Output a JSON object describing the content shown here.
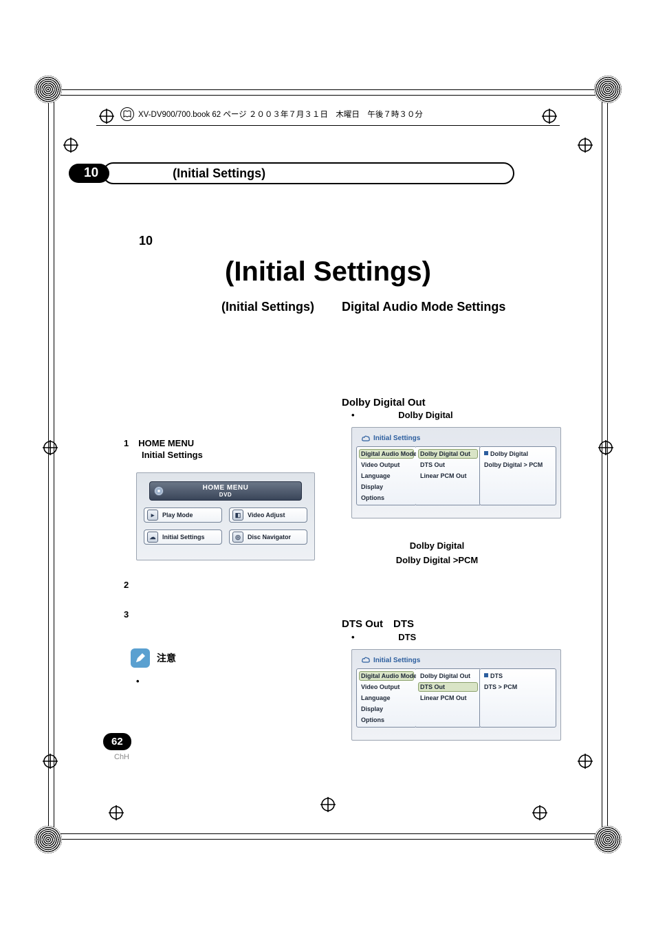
{
  "book_header": "XV-DV900/700.book  62 ページ  ２００３年７月３１日　木曜日　午後７時３０分",
  "chapter": {
    "number": "10",
    "tab_title": "(Initial Settings)"
  },
  "page": {
    "chapter_small": "10",
    "title_big": "(Initial Settings)",
    "page_number": "62",
    "page_sub": "ChH"
  },
  "left": {
    "heading": "(Initial Settings)",
    "step1_num": "1",
    "step1_text": "HOME MENU",
    "step1_sub": "Initial Settings",
    "step2_num": "2",
    "step3_num": "3",
    "note_label": "注意",
    "note_bullet": "•",
    "home_menu": {
      "title": "HOME MENU",
      "sub": "DVD",
      "buttons": [
        {
          "label": "Play Mode",
          "icon": "▸"
        },
        {
          "label": "Video Adjust",
          "icon": "◧"
        },
        {
          "label": "Initial Settings",
          "icon": "☁"
        },
        {
          "label": "Disc Navigator",
          "icon": "◎"
        }
      ]
    }
  },
  "right": {
    "heading": "Digital Audio Mode Settings",
    "dolby": {
      "heading": "Dolby Digital Out",
      "sub_bullet": "•",
      "sub": "Dolby Digital",
      "caption_line1": "Dolby Digital",
      "caption_line2": "Dolby Digital >PCM",
      "screenshot": {
        "title": "Initial Settings",
        "col1": [
          "Digital Audio Mode",
          "Video Output",
          "Language",
          "Display",
          "Options"
        ],
        "col1_highlight_index": 0,
        "col2": [
          "Dolby Digital Out",
          "DTS Out",
          "Linear PCM Out"
        ],
        "col2_highlight_index": 0,
        "col3": [
          "Dolby Digital",
          "Dolby Digital > PCM"
        ],
        "col3_marker_index": 0
      }
    },
    "dts": {
      "heading": "DTS Out　DTS",
      "sub_bullet": "•",
      "sub": "DTS",
      "screenshot": {
        "title": "Initial Settings",
        "col1": [
          "Digital Audio Mode",
          "Video Output",
          "Language",
          "Display",
          "Options"
        ],
        "col1_highlight_index": 0,
        "col2": [
          "Dolby Digital Out",
          "DTS Out",
          "Linear PCM Out"
        ],
        "col2_highlight_index": 1,
        "col3": [
          "DTS",
          "DTS > PCM"
        ],
        "col3_marker_index": 0
      }
    }
  }
}
